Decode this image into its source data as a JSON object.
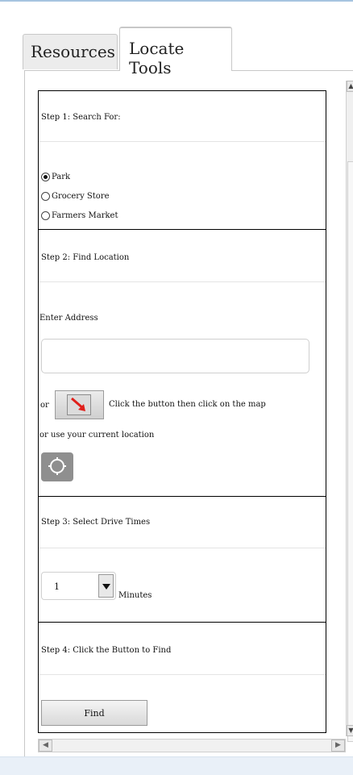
{
  "tabs": [
    {
      "label": "Resources",
      "active": false
    },
    {
      "label": "Locate Tools",
      "active": true
    }
  ],
  "step1": {
    "header": "Step 1: Search For:",
    "options": [
      {
        "label": "Park",
        "selected": true
      },
      {
        "label": "Grocery Store",
        "selected": false
      },
      {
        "label": "Farmers Market",
        "selected": false
      }
    ]
  },
  "step2": {
    "header": "Step 2: Find Location",
    "address_label": "Enter Address",
    "address_value": "",
    "or_label": "or",
    "map_button_hint": "Click the button then click on the map",
    "current_location_label": "or use your current location",
    "map_button_icon": "pointer-arrow-icon",
    "locate_button_icon": "crosshair-icon"
  },
  "step3": {
    "header": "Step 3: Select Drive Times",
    "drive_time_value": "1",
    "unit_label": "Minutes"
  },
  "step4": {
    "header": "Step 4: Click the Button to Find",
    "find_label": "Find"
  },
  "colors": {
    "accent": "#a6c4e0",
    "pointer_arrow": "#e0201b"
  }
}
